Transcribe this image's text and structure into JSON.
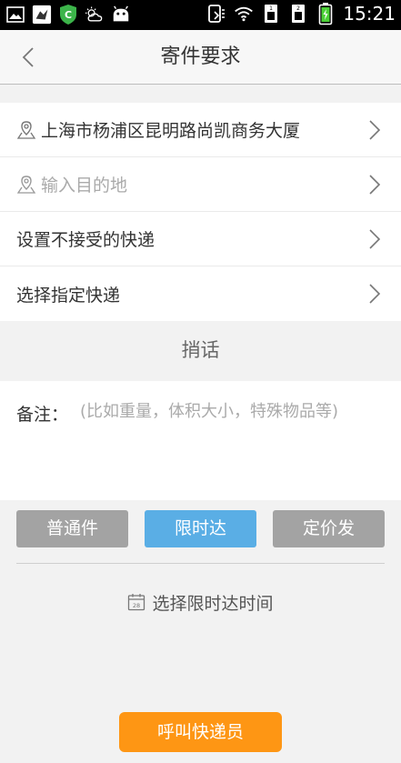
{
  "status_bar": {
    "time": "15:21",
    "left_icons": [
      "gallery-icon",
      "bird-app-icon",
      "shield-app-icon",
      "weather-icon",
      "android-icon"
    ],
    "right_icons": [
      "signal-icon",
      "wifi-icon",
      "sim1-icon",
      "sim2-icon",
      "battery-icon"
    ]
  },
  "header": {
    "title": "寄件要求"
  },
  "rows": [
    {
      "text": "上海市杨浦区昆明路尚凯商务大厦",
      "icon": "location-pin-icon"
    },
    {
      "placeholder": "输入目的地",
      "icon": "location-pin-icon"
    },
    {
      "text": "设置不接受的快递"
    },
    {
      "text": "选择指定快递"
    }
  ],
  "shaohua_label": "捎话",
  "note": {
    "label": "备注：",
    "placeholder": "(比如重量，体积大小，特殊物品等)"
  },
  "tabs": [
    {
      "label": "普通件",
      "active": false
    },
    {
      "label": "限时达",
      "active": true
    },
    {
      "label": "定价发",
      "active": false
    }
  ],
  "time_picker": {
    "label": "选择限时达时间",
    "icon": "calendar-icon"
  },
  "call_button": {
    "label": "呼叫快递员"
  },
  "colors": {
    "accent_blue": "#5aaee5",
    "orange": "#fe9614",
    "inactive_tab": "#a3a3a3"
  }
}
